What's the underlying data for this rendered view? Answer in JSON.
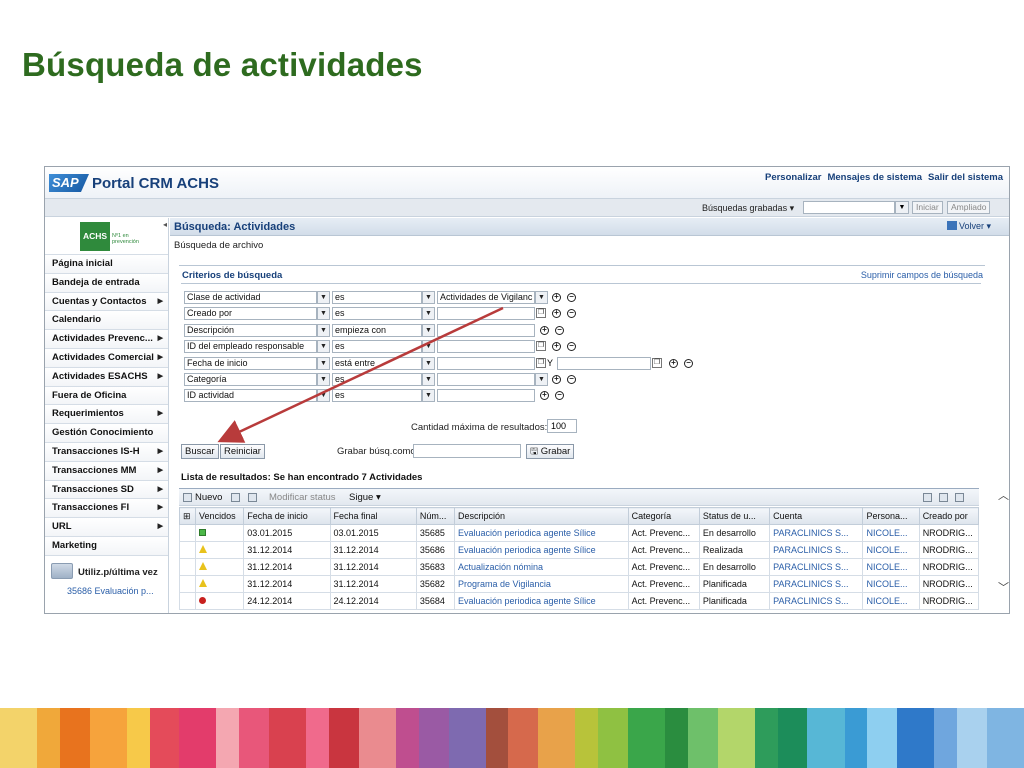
{
  "slide": {
    "title": "Búsqueda de actividades"
  },
  "header": {
    "app_title": "Portal CRM ACHS",
    "logo_text": "SAP",
    "links": [
      "Personalizar",
      "Mensajes de sistema",
      "Salir del sistema"
    ]
  },
  "toolbar": {
    "saved_searches": "Búsquedas grabadas",
    "start_btn": "Iniciar",
    "extended_btn": "Ampliado"
  },
  "sidebar": {
    "logo_text": "ACHS",
    "logo_sub": "Nº1 en prevención",
    "items": [
      {
        "label": "Página inicial",
        "arrow": false
      },
      {
        "label": "Bandeja de entrada",
        "arrow": false
      },
      {
        "label": "Cuentas y Contactos",
        "arrow": true
      },
      {
        "label": "Calendario",
        "arrow": false
      },
      {
        "label": "Actividades Prevenc...",
        "arrow": true
      },
      {
        "label": "Actividades Comercial",
        "arrow": true
      },
      {
        "label": "Actividades ESACHS",
        "arrow": true
      },
      {
        "label": "Fuera de Oficina",
        "arrow": false
      },
      {
        "label": "Requerimientos",
        "arrow": true
      },
      {
        "label": "Gestión Conocimiento",
        "arrow": false
      },
      {
        "label": "Transacciones IS-H",
        "arrow": true
      },
      {
        "label": "Transacciones MM",
        "arrow": true
      },
      {
        "label": "Transacciones SD",
        "arrow": true
      },
      {
        "label": "Transacciones FI",
        "arrow": true
      },
      {
        "label": "URL",
        "arrow": true
      },
      {
        "label": "Marketing",
        "arrow": false
      }
    ],
    "recent_label": "Utiliz.p/última vez",
    "recent_item": "35686 Evaluación p..."
  },
  "main": {
    "title": "Búsqueda: Actividades",
    "back_label": "Volver",
    "subtitle": "Búsqueda de archivo",
    "criteria_title": "Criterios de búsqueda",
    "clear_fields": "Suprimir campos de búsqueda",
    "criteria": [
      {
        "field": "Clase de actividad",
        "op": "es",
        "value": "Actividades de Vigilanc",
        "value_dd": true
      },
      {
        "field": "Creado por",
        "op": "es",
        "value": "",
        "value_help": true
      },
      {
        "field": "Descripción",
        "op": "empieza con",
        "value": ""
      },
      {
        "field": "ID del empleado responsable",
        "op": "es",
        "value": "",
        "value_help": true
      },
      {
        "field": "Fecha de inicio",
        "op": "está entre",
        "value": "",
        "value_help": true,
        "and_label": "Y",
        "value2": ""
      },
      {
        "field": "Categoría",
        "op": "es",
        "value": "",
        "value_dd": true
      },
      {
        "field": "ID actividad",
        "op": "es",
        "value": ""
      }
    ],
    "max_results_label": "Cantidad máxima de resultados:",
    "max_results": "100",
    "search_btn": "Buscar",
    "reset_btn": "Reiniciar",
    "save_as_label": "Grabar búsq.como:",
    "save_btn": "Grabar",
    "results_title": "Lista de resultados: Se han encontrado 7 Actividades",
    "results_toolbar": {
      "new": "Nuevo",
      "modify_status": "Modificar status",
      "next": "Sigue"
    },
    "columns": [
      "Vencidos",
      "Fecha de inicio",
      "Fecha final",
      "Núm...",
      "Descripción",
      "Categoría",
      "Status de u...",
      "Cuenta",
      "Persona...",
      "Creado por"
    ],
    "rows": [
      {
        "status": "green",
        "start": "03.01.2015",
        "end": "03.01.2015",
        "num": "35685",
        "desc": "Evaluación periodica agente Sílice",
        "cat": "Act. Prevenc...",
        "stat": "En desarrollo",
        "account": "PARACLINICS S...",
        "person": "NICOLE...",
        "creator": "NRODRIG..."
      },
      {
        "status": "warn",
        "start": "31.12.2014",
        "end": "31.12.2014",
        "num": "35686",
        "desc": "Evaluación periodica agente Sílice",
        "cat": "Act. Prevenc...",
        "stat": "Realizada",
        "account": "PARACLINICS S...",
        "person": "NICOLE...",
        "creator": "NRODRIG..."
      },
      {
        "status": "warn",
        "start": "31.12.2014",
        "end": "31.12.2014",
        "num": "35683",
        "desc": "Actualización nómina",
        "cat": "Act. Prevenc...",
        "stat": "En desarrollo",
        "account": "PARACLINICS S...",
        "person": "NICOLE...",
        "creator": "NRODRIG..."
      },
      {
        "status": "warn",
        "start": "31.12.2014",
        "end": "31.12.2014",
        "num": "35682",
        "desc": "Programa de Vigilancia",
        "cat": "Act. Prevenc...",
        "stat": "Planificada",
        "account": "PARACLINICS S...",
        "person": "NICOLE...",
        "creator": "NRODRIG..."
      },
      {
        "status": "red",
        "start": "24.12.2014",
        "end": "24.12.2014",
        "num": "35684",
        "desc": "Evaluación periodica agente Sílice",
        "cat": "Act. Prevenc...",
        "stat": "Planificada",
        "account": "PARACLINICS S...",
        "person": "NICOLE...",
        "creator": "NRODRIG..."
      }
    ]
  },
  "colors": {
    "title_green": "#2e6b1f",
    "annotation_arrow": "#b83b3b",
    "stripes": [
      "#f3d36a",
      "#f0a83a",
      "#e8731e",
      "#f6a33c",
      "#f7c949",
      "#e44b5a",
      "#e33c6b",
      "#f4a7b1",
      "#e8577a",
      "#d9414f",
      "#f06a8c",
      "#c9353f",
      "#ea8b8f",
      "#bf4e8f",
      "#9a5aa4",
      "#7e6ab0",
      "#a34f3d",
      "#d6694c",
      "#e8a24a",
      "#b8c33a",
      "#8fc142",
      "#3aa64a",
      "#2a8d3f",
      "#6ec06a",
      "#b3d66a",
      "#2e9c5b",
      "#1c8d5a",
      "#57b7d6",
      "#3a9bd4",
      "#8ecff0",
      "#2f79c9",
      "#6fa6de",
      "#a9d1ee",
      "#7fb5e2"
    ]
  }
}
